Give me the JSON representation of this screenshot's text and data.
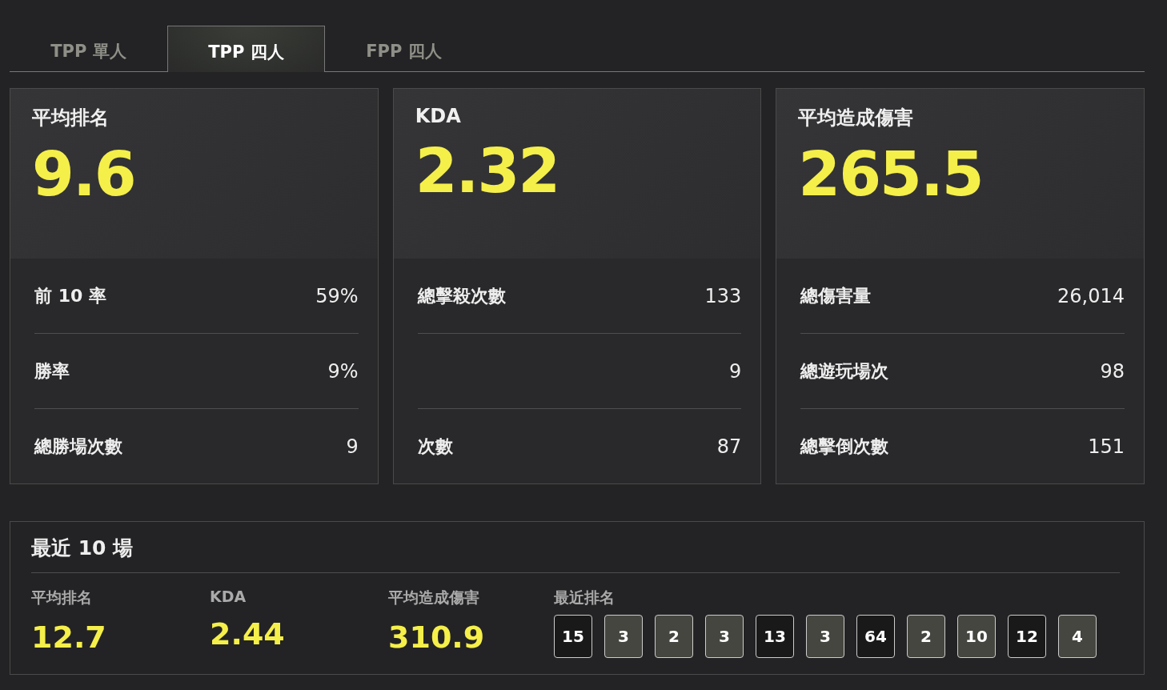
{
  "tabs": [
    {
      "label": "TPP 單人",
      "selected": false
    },
    {
      "label": "TPP 四人",
      "selected": true
    },
    {
      "label": "FPP 四人",
      "selected": false
    }
  ],
  "cards": [
    {
      "title": "平均排名",
      "value": "9.6",
      "rows": [
        {
          "label": "前 10 率",
          "value": "59%"
        },
        {
          "label": "勝率",
          "value": "9%"
        },
        {
          "label": "總勝場次數",
          "value": "9"
        }
      ]
    },
    {
      "title": "KDA",
      "value": "2.32",
      "rows": [
        {
          "label": "總擊殺次數",
          "value": "133"
        },
        {
          "value": "9"
        },
        {
          "label": "次數",
          "value": "87"
        }
      ]
    },
    {
      "title": "平均造成傷害",
      "value": "265.5",
      "rows": [
        {
          "label": "總傷害量",
          "value": "26,014"
        },
        {
          "label": "總遊玩場次",
          "value": "98"
        },
        {
          "label": "總擊倒次數",
          "value": "151"
        }
      ]
    }
  ],
  "recent": {
    "title": "最近 10 場",
    "stats": [
      {
        "label": "平均排名",
        "value": "12.7"
      },
      {
        "label": "KDA",
        "value": "2.44"
      },
      {
        "label": "平均造成傷害",
        "value": "310.9"
      }
    ],
    "ranks_label": "最近排名",
    "ranks": [
      {
        "value": "15",
        "top10": false
      },
      {
        "value": "3",
        "top10": true
      },
      {
        "value": "2",
        "top10": true
      },
      {
        "value": "3",
        "top10": true
      },
      {
        "value": "13",
        "top10": false
      },
      {
        "value": "3",
        "top10": true
      },
      {
        "value": "64",
        "top10": false
      },
      {
        "value": "2",
        "top10": true
      },
      {
        "value": "10",
        "top10": true
      },
      {
        "value": "12",
        "top10": false
      },
      {
        "value": "4",
        "top10": true
      }
    ]
  }
}
